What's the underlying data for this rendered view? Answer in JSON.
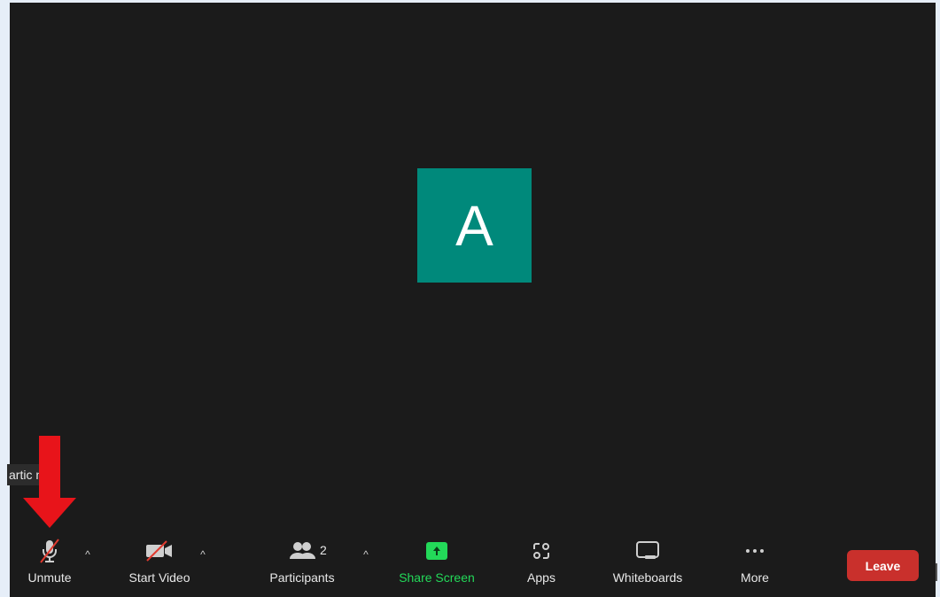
{
  "participant": {
    "initial": "A",
    "name_tag": "artic  nt",
    "avatar_color": "#00897b"
  },
  "toolbar": {
    "unmute_label": "Unmute",
    "start_video_label": "Start Video",
    "participants_label": "Participants",
    "participants_count": "2",
    "share_screen_label": "Share Screen",
    "apps_label": "Apps",
    "whiteboards_label": "Whiteboards",
    "more_label": "More",
    "leave_label": "Leave"
  },
  "colors": {
    "background": "#1b1b1b",
    "share_green": "#23d959",
    "leave_red": "#c9302c",
    "annotation_arrow": "#e8141a"
  },
  "icons": {
    "unmute": "microphone-muted-icon",
    "start_video": "video-camera-off-icon",
    "participants": "people-icon",
    "share_screen": "share-screen-arrow-icon",
    "apps": "apps-icon",
    "whiteboards": "whiteboard-icon",
    "more": "more-dots-icon",
    "annotation": "red-down-arrow-icon"
  }
}
